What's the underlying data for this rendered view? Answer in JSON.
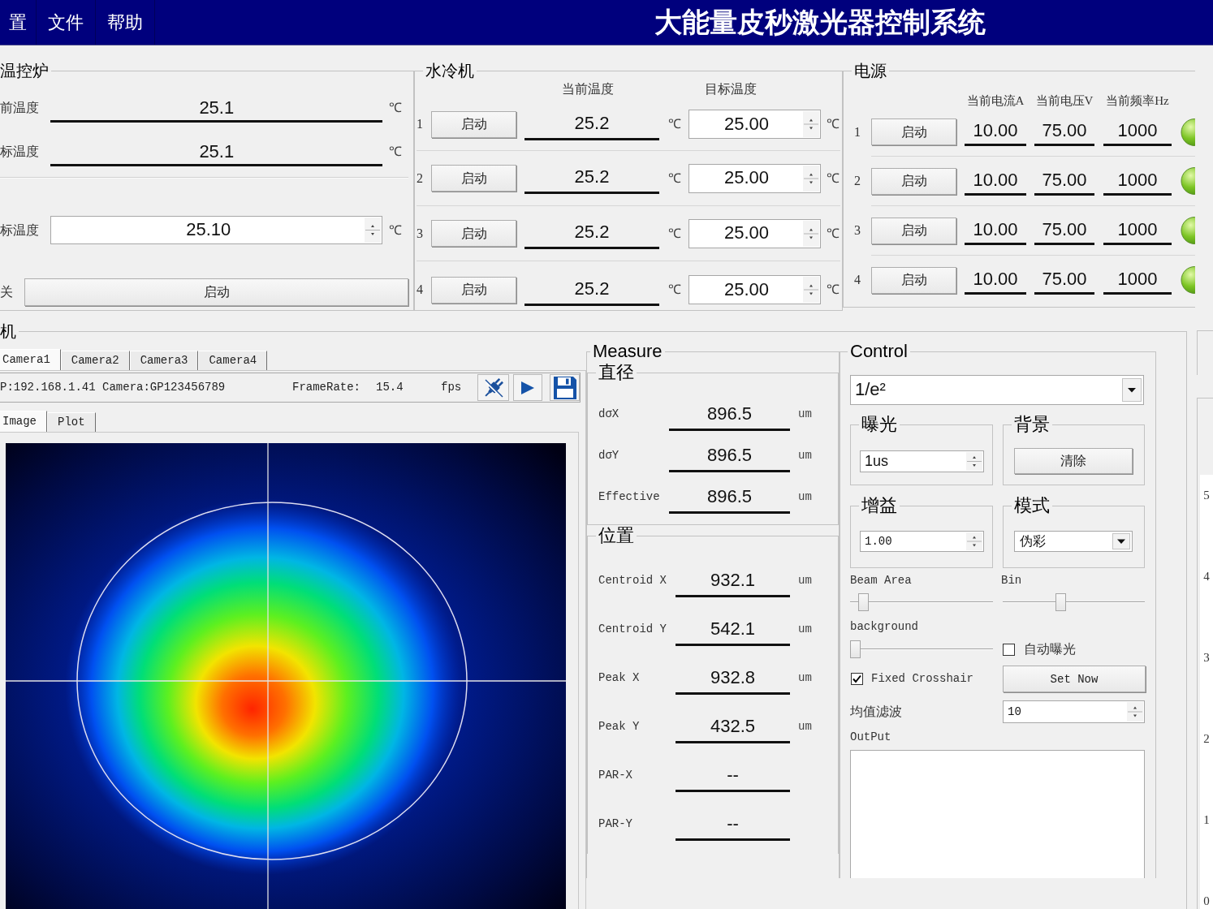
{
  "menu_bar": {
    "items": [
      "置",
      "文件",
      "帮助"
    ],
    "title": "大能量皮秒激光器控制系统"
  },
  "furnace": {
    "title": "温控炉",
    "readings": [
      {
        "label": "前温度",
        "value": "25.1",
        "unit": "℃"
      },
      {
        "label": "标温度",
        "value": "25.1",
        "unit": "℃"
      }
    ],
    "setpoint": {
      "label": "标温度",
      "value": "25.10",
      "unit": "℃"
    },
    "switch": {
      "label": "关",
      "button": "启动"
    }
  },
  "chiller": {
    "title": "水冷机",
    "columns": [
      "当前温度",
      "目标温度"
    ],
    "rows": [
      {
        "index": "1",
        "button": "启动",
        "current": "25.2",
        "current_unit": "℃",
        "target": "25.00",
        "target_unit": "℃"
      },
      {
        "index": "2",
        "button": "启动",
        "current": "25.2",
        "current_unit": "℃",
        "target": "25.00",
        "target_unit": "℃"
      },
      {
        "index": "3",
        "button": "启动",
        "current": "25.2",
        "current_unit": "℃",
        "target": "25.00",
        "target_unit": "℃"
      },
      {
        "index": "4",
        "button": "启动",
        "current": "25.2",
        "current_unit": "℃",
        "target": "25.00",
        "target_unit": "℃"
      }
    ]
  },
  "power": {
    "title": "电源",
    "columns": [
      "当前电流A",
      "当前电压V",
      "当前频率Hz"
    ],
    "rows": [
      {
        "index": "1",
        "button": "启动",
        "current": "10.00",
        "voltage": "75.00",
        "frequency": "1000",
        "indicator_on": true
      },
      {
        "index": "2",
        "button": "启动",
        "current": "10.00",
        "voltage": "75.00",
        "frequency": "1000",
        "indicator_on": true
      },
      {
        "index": "3",
        "button": "启动",
        "current": "10.00",
        "voltage": "75.00",
        "frequency": "1000",
        "indicator_on": true
      },
      {
        "index": "4",
        "button": "启动",
        "current": "10.00",
        "voltage": "75.00",
        "frequency": "1000",
        "indicator_on": true
      }
    ]
  },
  "camera": {
    "title": "机",
    "tabs": [
      {
        "label": "Camera1",
        "selected": true
      },
      {
        "label": "Camera2",
        "selected": false
      },
      {
        "label": "Camera3",
        "selected": false
      },
      {
        "label": "Camera4",
        "selected": false
      }
    ],
    "info": {
      "device": "P:192.168.1.41 Camera:GP123456789",
      "frame_rate_label": "FrameRate:",
      "frame_rate": "15.4",
      "frame_rate_unit": "fps"
    },
    "view_tabs": [
      {
        "label": "Image",
        "selected": true
      },
      {
        "label": "Plot",
        "selected": false
      }
    ]
  },
  "measure": {
    "title": "Measure",
    "groups": [
      {
        "title": "直径",
        "rows": [
          {
            "label": "dσX",
            "value": "896.5",
            "unit": "um"
          },
          {
            "label": "dσY",
            "value": "896.5",
            "unit": "um"
          },
          {
            "label": "Effective",
            "value": "896.5",
            "unit": "um"
          }
        ]
      },
      {
        "title": "位置",
        "rows": [
          {
            "label": "Centroid X",
            "value": "932.1",
            "unit": "um"
          },
          {
            "label": "Centroid Y",
            "value": "542.1",
            "unit": "um"
          },
          {
            "label": "Peak X",
            "value": "932.8",
            "unit": "um"
          },
          {
            "label": "Peak Y",
            "value": "432.5",
            "unit": "um"
          },
          {
            "label": "PAR-X",
            "value": "--"
          },
          {
            "label": "PAR-Y",
            "value": "--"
          }
        ]
      }
    ]
  },
  "control": {
    "title": "Control",
    "method": "1/e²",
    "exposure": {
      "title": "曝光",
      "value": "1us"
    },
    "background": {
      "title": "背景",
      "button": "清除"
    },
    "gain": {
      "title": "增益",
      "value": "1.00"
    },
    "mode": {
      "title": "模式",
      "value": "伪彩"
    },
    "beam_area": {
      "label": "Beam Area",
      "level": 0.06
    },
    "bin": {
      "label": "Bin",
      "level": 0.4
    },
    "background_slider": {
      "label": "background",
      "level": 0
    },
    "auto_exposure": {
      "label": "自动曝光",
      "checked": false
    },
    "fixed_crosshair": {
      "label": "Fixed Crosshair",
      "checked": true
    },
    "set_now_button": "Set Now",
    "mean_filter": {
      "label": "均值滤波",
      "value": "10"
    },
    "output": {
      "label": "OutPut"
    }
  },
  "side_panel": {
    "axis_labels": [
      "5",
      "4",
      "3",
      "2",
      "1",
      "0"
    ]
  }
}
